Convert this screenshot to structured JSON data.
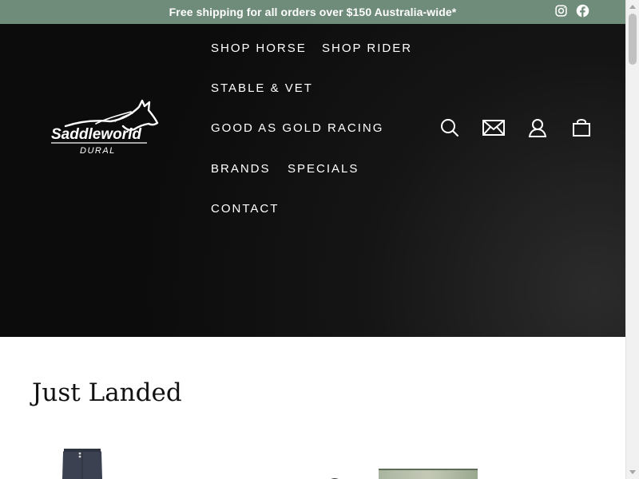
{
  "announcement": {
    "text": "Free shipping for all orders over $150 Australia-wide*"
  },
  "social": {
    "icons": [
      "instagram-icon",
      "facebook-icon"
    ]
  },
  "logo": {
    "brand": "Saddleworld",
    "location": "DURAL"
  },
  "nav": {
    "items": [
      {
        "label": "SHOP HORSE"
      },
      {
        "label": "SHOP RIDER"
      },
      {
        "label": "STABLE & VET"
      },
      {
        "label": "GOOD AS GOLD RACING"
      },
      {
        "label": "BRANDS"
      },
      {
        "label": "SPECIALS"
      },
      {
        "label": "CONTACT"
      }
    ]
  },
  "header_icons": [
    "search-icon",
    "envelope-icon",
    "account-icon",
    "cart-icon"
  ],
  "colors": {
    "announcement_bg": "#6f8c7a",
    "header_bg": "#0c0c0c",
    "text_light": "#ffffff",
    "text_dark": "#111111"
  },
  "section": {
    "title": "Just Landed"
  }
}
